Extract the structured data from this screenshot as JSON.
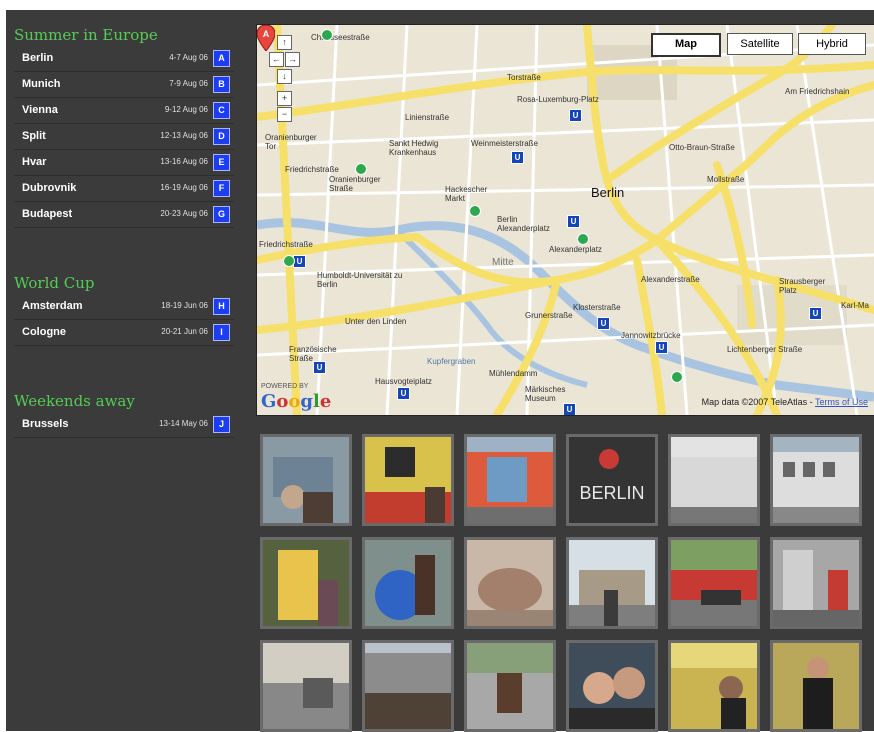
{
  "sections": [
    {
      "title": "Summer in Europe",
      "trips": [
        {
          "city": "Berlin",
          "dates": "4-7 Aug 06",
          "badge": "A"
        },
        {
          "city": "Munich",
          "dates": "7-9 Aug 06",
          "badge": "B"
        },
        {
          "city": "Vienna",
          "dates": "9-12 Aug 06",
          "badge": "C"
        },
        {
          "city": "Split",
          "dates": "12-13 Aug 06",
          "badge": "D"
        },
        {
          "city": "Hvar",
          "dates": "13-16 Aug 06",
          "badge": "E"
        },
        {
          "city": "Dubrovnik",
          "dates": "16-19 Aug 06",
          "badge": "F"
        },
        {
          "city": "Budapest",
          "dates": "20-23 Aug 06",
          "badge": "G"
        }
      ]
    },
    {
      "title": "World Cup",
      "trips": [
        {
          "city": "Amsterdam",
          "dates": "18-19 Jun 06",
          "badge": "H"
        },
        {
          "city": "Cologne",
          "dates": "20-21 Jun 06",
          "badge": "I"
        }
      ]
    },
    {
      "title": "Weekends away",
      "trips": [
        {
          "city": "Brussels",
          "dates": "13-14 May 06",
          "badge": "J"
        }
      ]
    }
  ],
  "map": {
    "type_buttons": [
      "Map",
      "Satellite",
      "Hybrid"
    ],
    "active_type": "Map",
    "pin_letter": "A",
    "city_label": "Berlin",
    "powered_by": "POWERED BY",
    "logo": "Google",
    "attribution": "Map data ©2007 TeleAtlas -",
    "terms": "Terms of Use",
    "labels": [
      "Torstraße",
      "Rosa-Luxemburg-Platz",
      "Oranienburger Tor",
      "Sankt Hedwig Krankenhaus",
      "Weinmeisterstraße",
      "Oranienburger Straße",
      "Hackescher Markt",
      "Berlin Alexanderplatz",
      "Alexanderplatz",
      "Friedrichstraße",
      "Humboldt-Universität zu Berlin",
      "Mitte",
      "Unter den Linden",
      "Klosterstraße",
      "Jannowitzbrücke",
      "Französische Straße",
      "Kupfergraben",
      "Hausvogteiplatz",
      "Märkisches Museum",
      "Strausberger Platz",
      "Karl-Ma",
      "Am Friedrichshain",
      "Otto-Braun-Straße",
      "Mollstraße",
      "Alexanderstraße",
      "Lichtenberger Straße",
      "Mühlendamm",
      "Grunerstraße",
      "Friedrichstraße",
      "Chausseestraße",
      "Linienstraße"
    ]
  },
  "nav_controls": [
    "↑",
    "←",
    "→",
    "↓",
    "+",
    "−"
  ],
  "photos": [
    {
      "alt": "berlin wall graffiti car"
    },
    {
      "alt": "wall mural and person"
    },
    {
      "alt": "east side gallery"
    },
    {
      "alt": "berlin sign"
    },
    {
      "alt": "wall text"
    },
    {
      "alt": "street building"
    },
    {
      "alt": "buddy bear"
    },
    {
      "alt": "globe statue"
    },
    {
      "alt": "stone basin"
    },
    {
      "alt": "brandenburg gate"
    },
    {
      "alt": "red cars street"
    },
    {
      "alt": "station"
    },
    {
      "alt": "street scene"
    },
    {
      "alt": "building terrace"
    },
    {
      "alt": "man sitting"
    },
    {
      "alt": "two friends"
    },
    {
      "alt": "woman in square"
    },
    {
      "alt": "man portrait"
    }
  ],
  "colors": {
    "sidebar_title": "#55cc55",
    "badge": "#1c3df0",
    "panel_bg": "#3b3b3b",
    "road": "#f6e06a"
  }
}
